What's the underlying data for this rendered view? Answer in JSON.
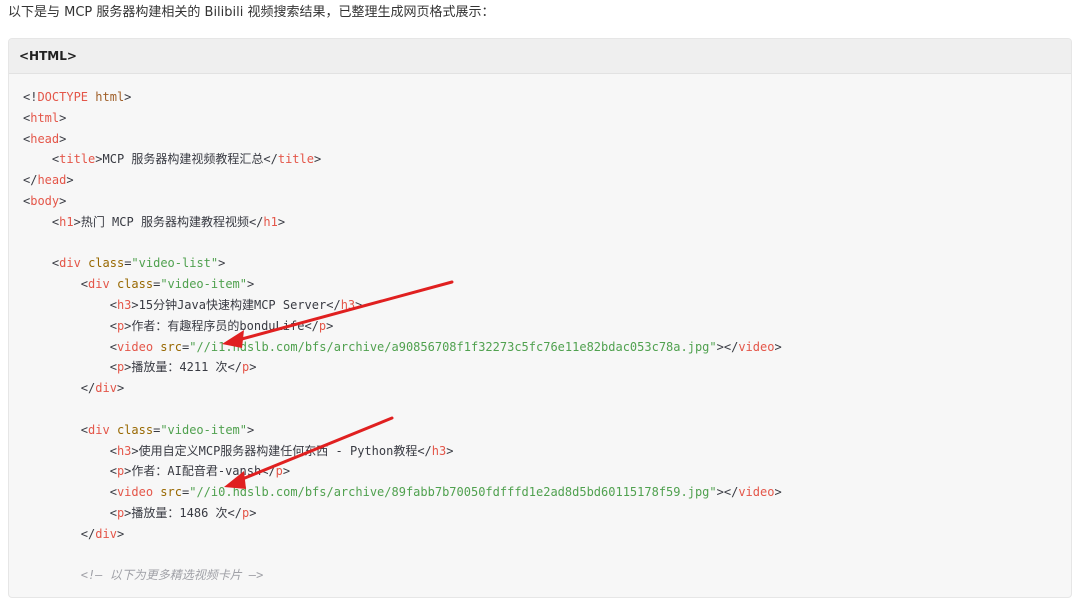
{
  "intro": {
    "text": "以下是与 MCP 服务器构建相关的 Bilibili 视频搜索结果，已整理生成网页格式展示："
  },
  "code_block": {
    "language_label": "<HTML>",
    "lines": [
      [
        {
          "t": "punct",
          "v": "<!"
        },
        {
          "t": "tag",
          "v": "DOCTYPE"
        },
        {
          "t": "text",
          "v": " "
        },
        {
          "t": "kw",
          "v": "html"
        },
        {
          "t": "punct",
          "v": ">"
        }
      ],
      [
        {
          "t": "punct",
          "v": "<"
        },
        {
          "t": "tag",
          "v": "html"
        },
        {
          "t": "punct",
          "v": ">"
        }
      ],
      [
        {
          "t": "punct",
          "v": "<"
        },
        {
          "t": "tag",
          "v": "head"
        },
        {
          "t": "punct",
          "v": ">"
        }
      ],
      [
        {
          "t": "text",
          "v": "    "
        },
        {
          "t": "punct",
          "v": "<"
        },
        {
          "t": "tag",
          "v": "title"
        },
        {
          "t": "punct",
          "v": ">"
        },
        {
          "t": "text",
          "v": "MCP 服务器构建视频教程汇总"
        },
        {
          "t": "punct",
          "v": "</"
        },
        {
          "t": "tag",
          "v": "title"
        },
        {
          "t": "punct",
          "v": ">"
        }
      ],
      [
        {
          "t": "punct",
          "v": "</"
        },
        {
          "t": "tag",
          "v": "head"
        },
        {
          "t": "punct",
          "v": ">"
        }
      ],
      [
        {
          "t": "punct",
          "v": "<"
        },
        {
          "t": "tag",
          "v": "body"
        },
        {
          "t": "punct",
          "v": ">"
        }
      ],
      [
        {
          "t": "text",
          "v": "    "
        },
        {
          "t": "punct",
          "v": "<"
        },
        {
          "t": "tag",
          "v": "h1"
        },
        {
          "t": "punct",
          "v": ">"
        },
        {
          "t": "text",
          "v": "热门 MCP 服务器构建教程视频"
        },
        {
          "t": "punct",
          "v": "</"
        },
        {
          "t": "tag",
          "v": "h1"
        },
        {
          "t": "punct",
          "v": ">"
        }
      ],
      [],
      [
        {
          "t": "text",
          "v": "    "
        },
        {
          "t": "punct",
          "v": "<"
        },
        {
          "t": "tag",
          "v": "div"
        },
        {
          "t": "text",
          "v": " "
        },
        {
          "t": "attr",
          "v": "class"
        },
        {
          "t": "punct",
          "v": "="
        },
        {
          "t": "str",
          "v": "\"video-list\""
        },
        {
          "t": "punct",
          "v": ">"
        }
      ],
      [
        {
          "t": "text",
          "v": "        "
        },
        {
          "t": "punct",
          "v": "<"
        },
        {
          "t": "tag",
          "v": "div"
        },
        {
          "t": "text",
          "v": " "
        },
        {
          "t": "attr",
          "v": "class"
        },
        {
          "t": "punct",
          "v": "="
        },
        {
          "t": "str",
          "v": "\"video-item\""
        },
        {
          "t": "punct",
          "v": ">"
        }
      ],
      [
        {
          "t": "text",
          "v": "            "
        },
        {
          "t": "punct",
          "v": "<"
        },
        {
          "t": "tag",
          "v": "h3"
        },
        {
          "t": "punct",
          "v": ">"
        },
        {
          "t": "text",
          "v": "15分钟Java快速构建MCP Server"
        },
        {
          "t": "punct",
          "v": "</"
        },
        {
          "t": "tag",
          "v": "h3"
        },
        {
          "t": "punct",
          "v": ">"
        }
      ],
      [
        {
          "t": "text",
          "v": "            "
        },
        {
          "t": "punct",
          "v": "<"
        },
        {
          "t": "tag",
          "v": "p"
        },
        {
          "t": "punct",
          "v": ">"
        },
        {
          "t": "text",
          "v": "作者：有趣程序员的bonduLife"
        },
        {
          "t": "punct",
          "v": "</"
        },
        {
          "t": "tag",
          "v": "p"
        },
        {
          "t": "punct",
          "v": ">"
        }
      ],
      [
        {
          "t": "text",
          "v": "            "
        },
        {
          "t": "punct",
          "v": "<"
        },
        {
          "t": "tag",
          "v": "video"
        },
        {
          "t": "text",
          "v": " "
        },
        {
          "t": "attr",
          "v": "src"
        },
        {
          "t": "punct",
          "v": "="
        },
        {
          "t": "str",
          "v": "\"//i1.hdslb.com/bfs/archive/a90856708f1f32273c5fc76e11e82bdac053c78a.jpg\""
        },
        {
          "t": "punct",
          "v": "></"
        },
        {
          "t": "tag",
          "v": "video"
        },
        {
          "t": "punct",
          "v": ">"
        }
      ],
      [
        {
          "t": "text",
          "v": "            "
        },
        {
          "t": "punct",
          "v": "<"
        },
        {
          "t": "tag",
          "v": "p"
        },
        {
          "t": "punct",
          "v": ">"
        },
        {
          "t": "text",
          "v": "播放量：4211 次"
        },
        {
          "t": "punct",
          "v": "</"
        },
        {
          "t": "tag",
          "v": "p"
        },
        {
          "t": "punct",
          "v": ">"
        }
      ],
      [
        {
          "t": "text",
          "v": "        "
        },
        {
          "t": "punct",
          "v": "</"
        },
        {
          "t": "tag",
          "v": "div"
        },
        {
          "t": "punct",
          "v": ">"
        }
      ],
      [],
      [
        {
          "t": "text",
          "v": "        "
        },
        {
          "t": "punct",
          "v": "<"
        },
        {
          "t": "tag",
          "v": "div"
        },
        {
          "t": "text",
          "v": " "
        },
        {
          "t": "attr",
          "v": "class"
        },
        {
          "t": "punct",
          "v": "="
        },
        {
          "t": "str",
          "v": "\"video-item\""
        },
        {
          "t": "punct",
          "v": ">"
        }
      ],
      [
        {
          "t": "text",
          "v": "            "
        },
        {
          "t": "punct",
          "v": "<"
        },
        {
          "t": "tag",
          "v": "h3"
        },
        {
          "t": "punct",
          "v": ">"
        },
        {
          "t": "text",
          "v": "使用自定义MCP服务器构建任何东西 - Python教程"
        },
        {
          "t": "punct",
          "v": "</"
        },
        {
          "t": "tag",
          "v": "h3"
        },
        {
          "t": "punct",
          "v": ">"
        }
      ],
      [
        {
          "t": "text",
          "v": "            "
        },
        {
          "t": "punct",
          "v": "<"
        },
        {
          "t": "tag",
          "v": "p"
        },
        {
          "t": "punct",
          "v": ">"
        },
        {
          "t": "text",
          "v": "作者：AI配音君-vansh"
        },
        {
          "t": "punct",
          "v": "</"
        },
        {
          "t": "tag",
          "v": "p"
        },
        {
          "t": "punct",
          "v": ">"
        }
      ],
      [
        {
          "t": "text",
          "v": "            "
        },
        {
          "t": "punct",
          "v": "<"
        },
        {
          "t": "tag",
          "v": "video"
        },
        {
          "t": "text",
          "v": " "
        },
        {
          "t": "attr",
          "v": "src"
        },
        {
          "t": "punct",
          "v": "="
        },
        {
          "t": "str",
          "v": "\"//i0.hdslb.com/bfs/archive/89fabb7b70050fdfffd1e2ad8d5bd60115178f59.jpg\""
        },
        {
          "t": "punct",
          "v": "></"
        },
        {
          "t": "tag",
          "v": "video"
        },
        {
          "t": "punct",
          "v": ">"
        }
      ],
      [
        {
          "t": "text",
          "v": "            "
        },
        {
          "t": "punct",
          "v": "<"
        },
        {
          "t": "tag",
          "v": "p"
        },
        {
          "t": "punct",
          "v": ">"
        },
        {
          "t": "text",
          "v": "播放量：1486 次"
        },
        {
          "t": "punct",
          "v": "</"
        },
        {
          "t": "tag",
          "v": "p"
        },
        {
          "t": "punct",
          "v": ">"
        }
      ],
      [
        {
          "t": "text",
          "v": "        "
        },
        {
          "t": "punct",
          "v": "</"
        },
        {
          "t": "tag",
          "v": "div"
        },
        {
          "t": "punct",
          "v": ">"
        }
      ],
      [],
      [
        {
          "t": "text",
          "v": "        "
        },
        {
          "t": "comment",
          "v": "<!— 以下为更多精选视频卡片 —>"
        }
      ]
    ]
  },
  "annotations": {
    "arrow_color": "#e02020"
  }
}
